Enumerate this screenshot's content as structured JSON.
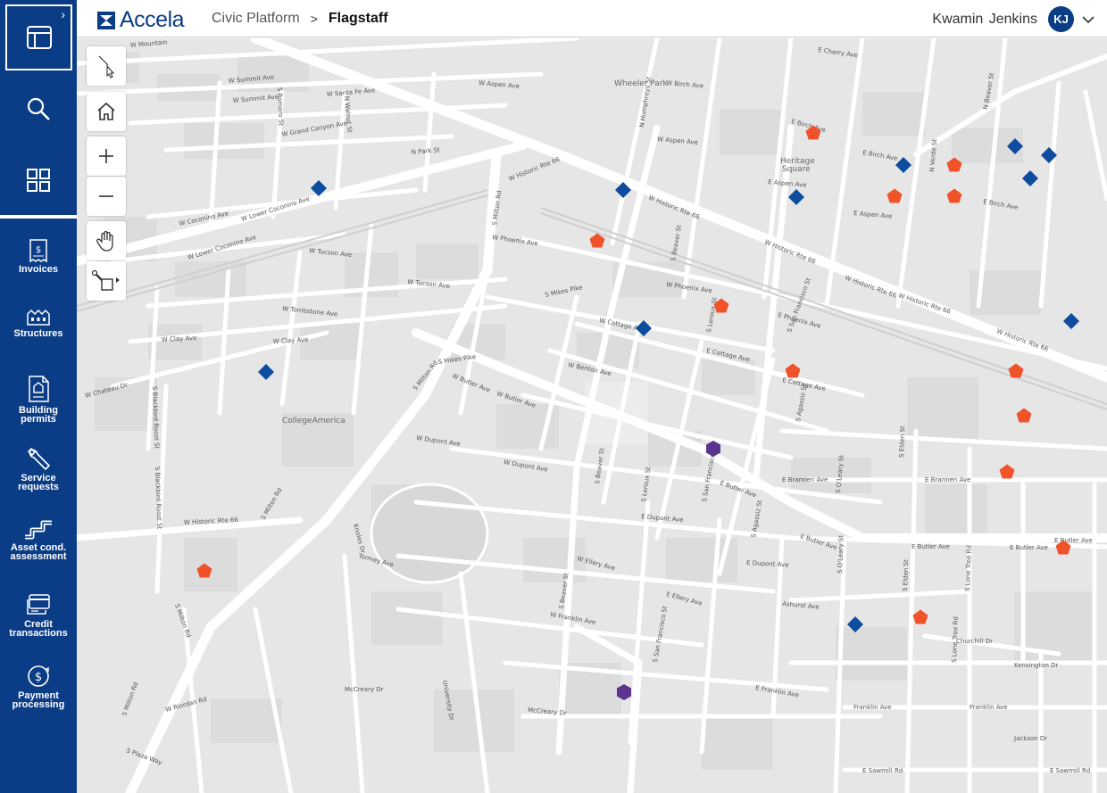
{
  "header": {
    "brand": "Accela",
    "breadcrumb": {
      "root": "Civic Platform",
      "separator": ">",
      "current": "Flagstaff"
    },
    "user_name": "Kwamin Jenkins",
    "user_initials": "KJ"
  },
  "rail": {
    "items": [
      {
        "label_line1": "Invoices",
        "label_line2": "",
        "icon": "invoice-icon"
      },
      {
        "label_line1": "Structures",
        "label_line2": "",
        "icon": "structures-icon"
      },
      {
        "label_line1": "Building",
        "label_line2": "permits",
        "icon": "building-permit-icon"
      },
      {
        "label_line1": "Service",
        "label_line2": "requests",
        "icon": "wrench-icon"
      },
      {
        "label_line1": "Asset cond.",
        "label_line2": "assessment",
        "icon": "pipe-icon"
      },
      {
        "label_line1": "Credit",
        "label_line2": "transactions",
        "icon": "credit-card-icon"
      },
      {
        "label_line1": "Payment",
        "label_line2": "processing",
        "icon": "payment-icon"
      }
    ]
  },
  "colors": {
    "brand": "#0b3d86",
    "marker_blue": "#0d4c9e",
    "marker_orange": "#f0522a",
    "marker_purple": "#5b3490"
  },
  "map": {
    "places": [
      "Wheeler Park",
      "Heritage",
      "Square",
      "CollegeAmerica"
    ],
    "streets": {
      "rte66_w": "W Historic Rte 66",
      "rte66_e": "W Historic Rte 66",
      "rte66_sw": "W Historic Rte 66",
      "milton": "S Milton Rd",
      "milton_lower": "S Milton Rd",
      "butler_w": "W Butler Ave",
      "butler_e": "E Butler Ave",
      "butler_e2": "E Butler Ave",
      "butler_e3": "E Butler Ave",
      "butler_e4": "E Butler Ave",
      "phoenix_w": "W Phoenix Ave",
      "phoenix_e": "W Phoenix Ave",
      "phoenix_far": "E Phoenix Ave",
      "aspen_w": "W Aspen Ave",
      "aspen_e": "E Aspen Ave",
      "birch_w": "W Birch Ave",
      "birch_e": "E Birch Ave",
      "cherry": "E Cherry Ave",
      "cottage_w": "W Cottage Ave",
      "cottage_e": "E Cottage Ave",
      "cottage_e2": "E Cottage Ave",
      "dupont_w": "W Dupont Ave",
      "dupont_e": "E Dupont Ave",
      "dupont_e2": "E Dupont Ave",
      "brannen": "E Brannen Ave",
      "brannen2": "E Brannen Ave",
      "clay_w": "W Clay Ave",
      "clay_w2": "W Clay Ave",
      "tucson": "W Tucson Ave",
      "tombstone": "W Tombstone Ave",
      "coconino": "W Coconino Ave",
      "lower_coconino": "W Lower Coconino Ave",
      "santa_fe": "W Santa Fe Ave",
      "summit": "W Summit Ave",
      "grand_canyon": "W Grand Canyon Ave",
      "chateau": "W Chateau Dr",
      "mikes_pike": "S Mikes Pike",
      "ellery": "W Ellery Ave",
      "ellery_e": "E Ellery Ave",
      "franklin_w": "W Franklin Ave",
      "franklin_e": "E Franklin Ave",
      "franklin_e2": "Franklin Ave",
      "sawmill": "E Sawmill Rd",
      "sawmill2": "E Sawmill Rd",
      "ashurst": "Ashurst Ave",
      "churchill": "Churchill Dr",
      "kensington": "Kensington Dr",
      "jackson": "Jackson Dr",
      "mccreary": "McCreary Dr",
      "humphreys": "N Humphreys St",
      "san_francisco": "S San Francisco St",
      "beaver": "S Beaver St",
      "leroux": "S Leroux St",
      "agassiz": "S Agassiz St",
      "oleary": "S O'Leary St",
      "elden": "S Elden St",
      "verde": "N Verde St",
      "beaver_n": "N Beaver St",
      "lone_tree": "S Lone Tree Rd",
      "university": "University Dr",
      "blackbird": "S Blackbird Roost St",
      "park": "N Park St",
      "romero": "S Romero St",
      "knoles": "Knoles Dr",
      "riordan": "W Riordan Rd",
      "plaza": "S Plaza Way",
      "tormey": "Tormey Ave",
      "benton": "W Benton Ave",
      "walnut": "N Walnut St",
      "mountain": "W Mountain"
    }
  }
}
